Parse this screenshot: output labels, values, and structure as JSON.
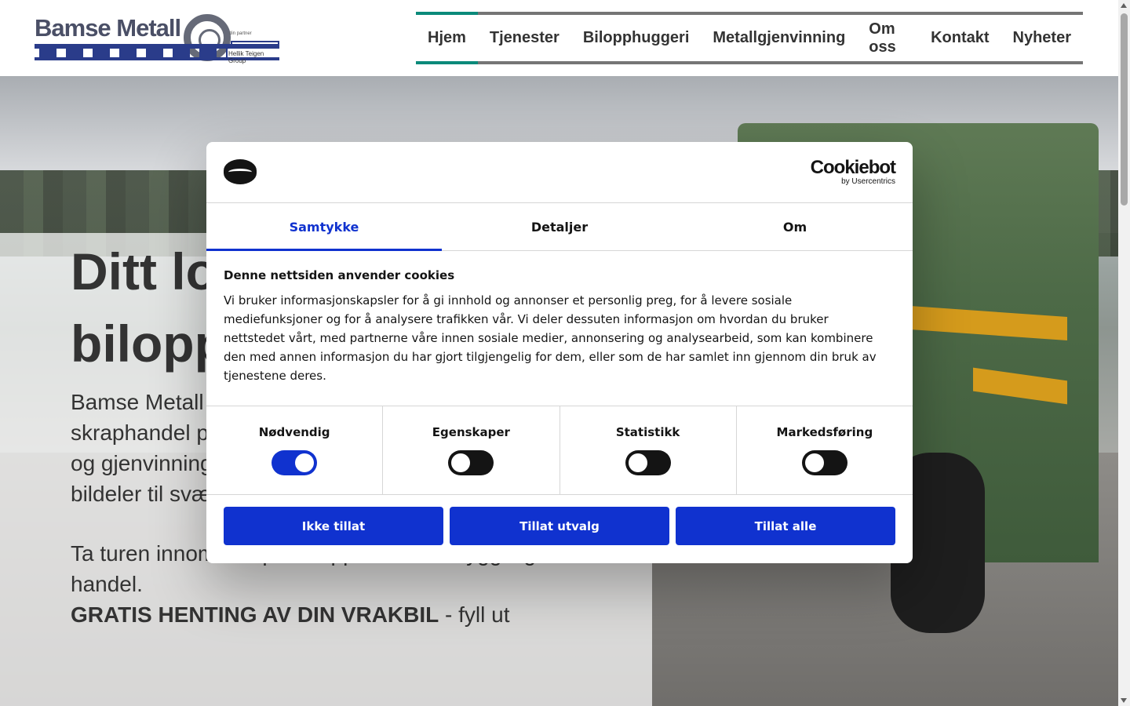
{
  "header": {
    "logo": {
      "name": "Bamse Metall",
      "tagline": "Hellik Teigen Group",
      "small_text": "din partner"
    },
    "nav": [
      {
        "label": "Hjem",
        "active": true
      },
      {
        "label": "Tjenester"
      },
      {
        "label": "Bilopphuggeri"
      },
      {
        "label": "Metallgjenvinning"
      },
      {
        "label": "Om oss"
      },
      {
        "label": "Kontakt"
      },
      {
        "label": "Nyheter"
      }
    ]
  },
  "hero": {
    "title_line1": "Ditt lo",
    "title_line2": "bilopp",
    "text_lines": [
      "Bamse Metall",
      "skraphandel p",
      "og gjenvinning",
      "bildeler til svært gode priser."
    ],
    "cta_line1": "Ta turen innom oss på Skoppum for en hyggelig",
    "cta_line2": "handel.",
    "cta_bold": "GRATIS HENTING AV DIN VRAKBIL",
    "cta_rest": " - fyll ut"
  },
  "cookie_dialog": {
    "brand": "Cookiebot",
    "brand_sub": "by Usercentrics",
    "tabs": [
      {
        "label": "Samtykke",
        "active": true
      },
      {
        "label": "Detaljer"
      },
      {
        "label": "Om"
      }
    ],
    "title": "Denne nettsiden anvender cookies",
    "body": "Vi bruker informasjonskapsler for å gi innhold og annonser et personlig preg, for å levere sosiale mediefunksjoner og for å analysere trafikken vår. Vi deler dessuten informasjon om hvordan du bruker nettstedet vårt, med partnerne våre innen sosiale medier, annonsering og analysearbeid, som kan kombinere den med annen informasjon du har gjort tilgjengelig for dem, eller som de har samlet inn gjennom din bruk av tjenestene deres.",
    "toggles": [
      {
        "label": "Nødvendig",
        "on": true
      },
      {
        "label": "Egenskaper",
        "on": false
      },
      {
        "label": "Statistikk",
        "on": false
      },
      {
        "label": "Markedsføring",
        "on": false
      }
    ],
    "buttons": {
      "deny": "Ikke tillat",
      "allow_selection": "Tillat utvalg",
      "allow_all": "Tillat alle"
    }
  },
  "colors": {
    "accent": "#1032cf",
    "nav_active": "#0b8a7a",
    "logo_blue": "#2a3c8a"
  }
}
